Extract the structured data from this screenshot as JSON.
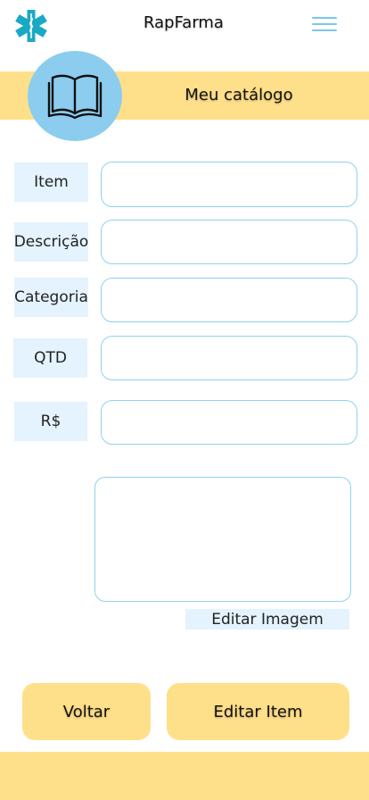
{
  "header": {
    "app_title": "RapFarma",
    "logo_icon": "medical-star-of-life-icon",
    "menu_icon": "hamburger-menu-icon"
  },
  "banner": {
    "title": "Meu catálogo",
    "icon": "open-book-icon"
  },
  "form": {
    "fields": [
      {
        "label": "Item",
        "value": "",
        "placeholder": ""
      },
      {
        "label": "Descrição",
        "value": "",
        "placeholder": ""
      },
      {
        "label": "Categoria",
        "value": "",
        "placeholder": ""
      },
      {
        "label": "QTD",
        "value": "",
        "placeholder": ""
      },
      {
        "label": "R$",
        "value": "",
        "placeholder": ""
      }
    ]
  },
  "image_section": {
    "edit_label": "Editar Imagem"
  },
  "actions": {
    "back_label": "Voltar",
    "edit_item_label": "Editar Item"
  },
  "colors": {
    "accent_yellow": "#ffe08a",
    "accent_blue": "#8ccdef",
    "label_background": "#e4f3fd",
    "logo_teal": "#1aa9c4"
  }
}
